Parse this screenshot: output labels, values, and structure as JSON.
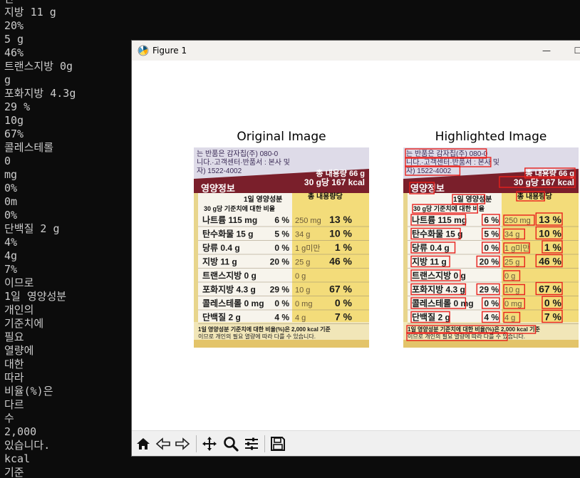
{
  "terminal": {
    "lines": [
      "단",
      "지방 11 g",
      "20%",
      "5 g",
      "46%",
      "트랜스지방 0g",
      "g",
      "포화지방 4.3g",
      "29 %",
      "10g",
      "67%",
      "콜레스테롤",
      "0",
      "mg",
      "0%",
      "0m",
      "0%",
      "단백질 2 g",
      "4%",
      "4g",
      "7%",
      "이므로",
      "1일 영양성분",
      "개인의",
      "기준치에",
      "필요",
      "열량에",
      "대한",
      "따라",
      "비율(%)은",
      "다르",
      "수",
      "2,000",
      "있습니다.",
      "kcal",
      "기준"
    ]
  },
  "window": {
    "title": "Figure 1",
    "minimize_glyph": "—",
    "maximize_glyph": "☐"
  },
  "figure": {
    "left_title": "Original Image",
    "right_title": "Highlighted Image"
  },
  "label": {
    "top_lines": [
      "는 반품은 감자칩(주) 080-0",
      "니다.·고객센터·반품서 : 본사 및",
      "자) 1522-4002"
    ],
    "total": "총 내용량 66 g",
    "per": "30 g당 167 kcal",
    "heading": "영양정보",
    "col_daily": "1일 영양성분",
    "col_total": "총 내용량당",
    "col_basis": "30 g당 기준치에 대한 비율",
    "rows": [
      {
        "name": "나트륨 115 mg",
        "pct": "6 %",
        "amt": "250 mg",
        "tpct": "13 %"
      },
      {
        "name": "탄수화물 15 g",
        "pct": "5 %",
        "amt": "34 g",
        "tpct": "10 %"
      },
      {
        "name": "당류 0.4 g",
        "pct": "0 %",
        "amt": "1 g미만",
        "tpct": "1 %"
      },
      {
        "name": "지방 11 g",
        "pct": "20 %",
        "amt": "25 g",
        "tpct": "46 %"
      },
      {
        "name": "트랜스지방 0 g",
        "pct": "",
        "amt": "0 g",
        "tpct": ""
      },
      {
        "name": "포화지방 4.3 g",
        "pct": "29 %",
        "amt": "10 g",
        "tpct": "67 %"
      },
      {
        "name": "콜레스테롤 0 mg",
        "pct": "0 %",
        "amt": "0 mg",
        "tpct": "0 %"
      },
      {
        "name": "단백질 2 g",
        "pct": "4 %",
        "amt": "4 g",
        "tpct": "7 %"
      }
    ],
    "footer1": "1일 영양성분 기준치에 대한 비율(%)은 2,000 kcal 기준",
    "footer2": "이므로 개인의 필요 열량에 따라 다를 수 있습니다."
  },
  "toolbar": {
    "buttons": [
      "home-icon",
      "back-icon",
      "forward-icon",
      "pan-icon",
      "zoom-icon",
      "configure-subplots-icon",
      "save-icon"
    ]
  },
  "colors": {
    "terminal_bg": "#0c0c0c",
    "terminal_text": "#cccccc",
    "label_maroon": "#7a1f2b",
    "label_yellow": "#f3dc7a",
    "highlight_box": "#e8201c"
  }
}
